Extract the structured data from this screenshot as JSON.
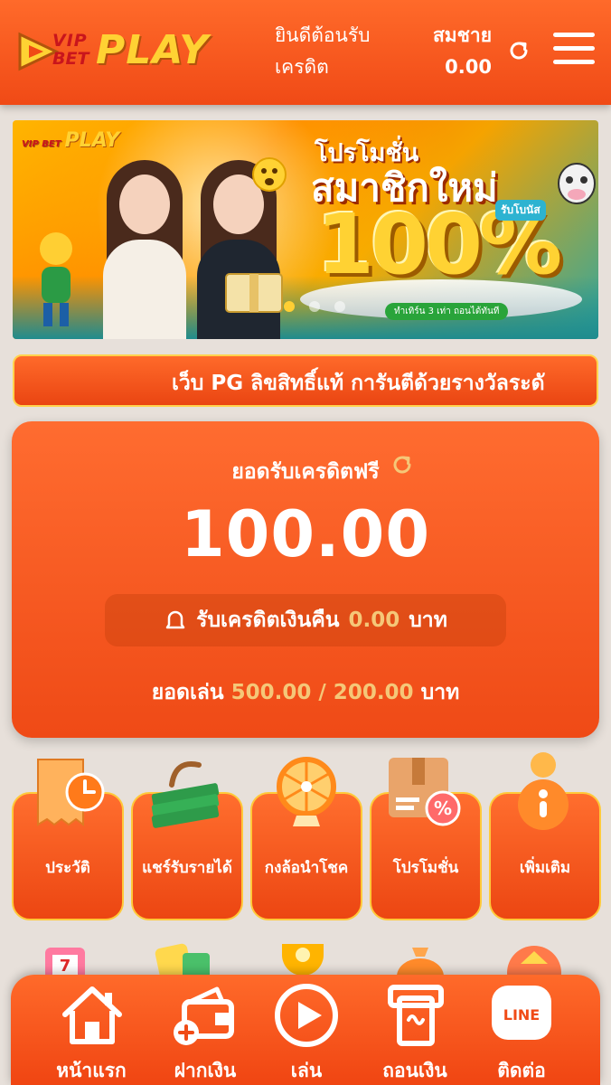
{
  "header": {
    "brand_small_1": "VIP",
    "brand_small_2": "BET",
    "brand_main": "PLAY",
    "welcome_line1": "ยินดีต้อนรับ",
    "welcome_line2": "เครดิต",
    "user_name": "สมชาย",
    "balance": "0.00",
    "refresh_icon": "refresh-icon",
    "menu_icon": "hamburger-icon"
  },
  "banner": {
    "logo_small": "VIP BET",
    "logo_main": "PLAY",
    "promo_title": "โปรโมชั่น",
    "promo_subtitle": "สมาชิกใหม่",
    "promo_badge": "รับโบนัส",
    "promo_percent": "100%",
    "promo_condition": "ทำเทิร์น 3 เท่า ถอนได้ทันที",
    "slides": 3,
    "active_slide": 0
  },
  "marquee": {
    "text": "เว็บ PG ลิขสิทธิ์แท้ การันตีด้วยรางวัลระดั"
  },
  "credit": {
    "label": "ยอดรับเครดิตฟรี",
    "amount": "100.00",
    "cashback_label": "รับเครดิตเงินคืน",
    "cashback_value": "0.00",
    "cashback_unit": "บาท",
    "turnover_label": "ยอดเล่น",
    "turnover_value": "500.00 / 200.00",
    "turnover_unit": "บาท"
  },
  "tiles": [
    {
      "label": "ประวัติ",
      "icon": "history-clock-icon"
    },
    {
      "label": "แชร์รับรายได้",
      "icon": "money-stack-icon"
    },
    {
      "label": "กงล้อนำโชค",
      "icon": "lucky-wheel-icon"
    },
    {
      "label": "โปรโมชั่น",
      "icon": "promo-box-icon"
    },
    {
      "label": "เพิ่มเติม",
      "icon": "info-more-icon"
    }
  ],
  "bottom_nav": [
    {
      "label": "หน้าแรก",
      "icon": "home-icon"
    },
    {
      "label": "ฝากเงิน",
      "icon": "deposit-wallet-icon"
    },
    {
      "label": "เล่น",
      "icon": "play-icon"
    },
    {
      "label": "ถอนเงิน",
      "icon": "withdraw-icon"
    },
    {
      "label": "ติดต่อ",
      "icon": "line-chat-icon"
    }
  ],
  "colors": {
    "primary": "#f04a16",
    "accent_gold": "#ffd233",
    "value_gold": "#f5c778",
    "background": "#e7e0da"
  }
}
